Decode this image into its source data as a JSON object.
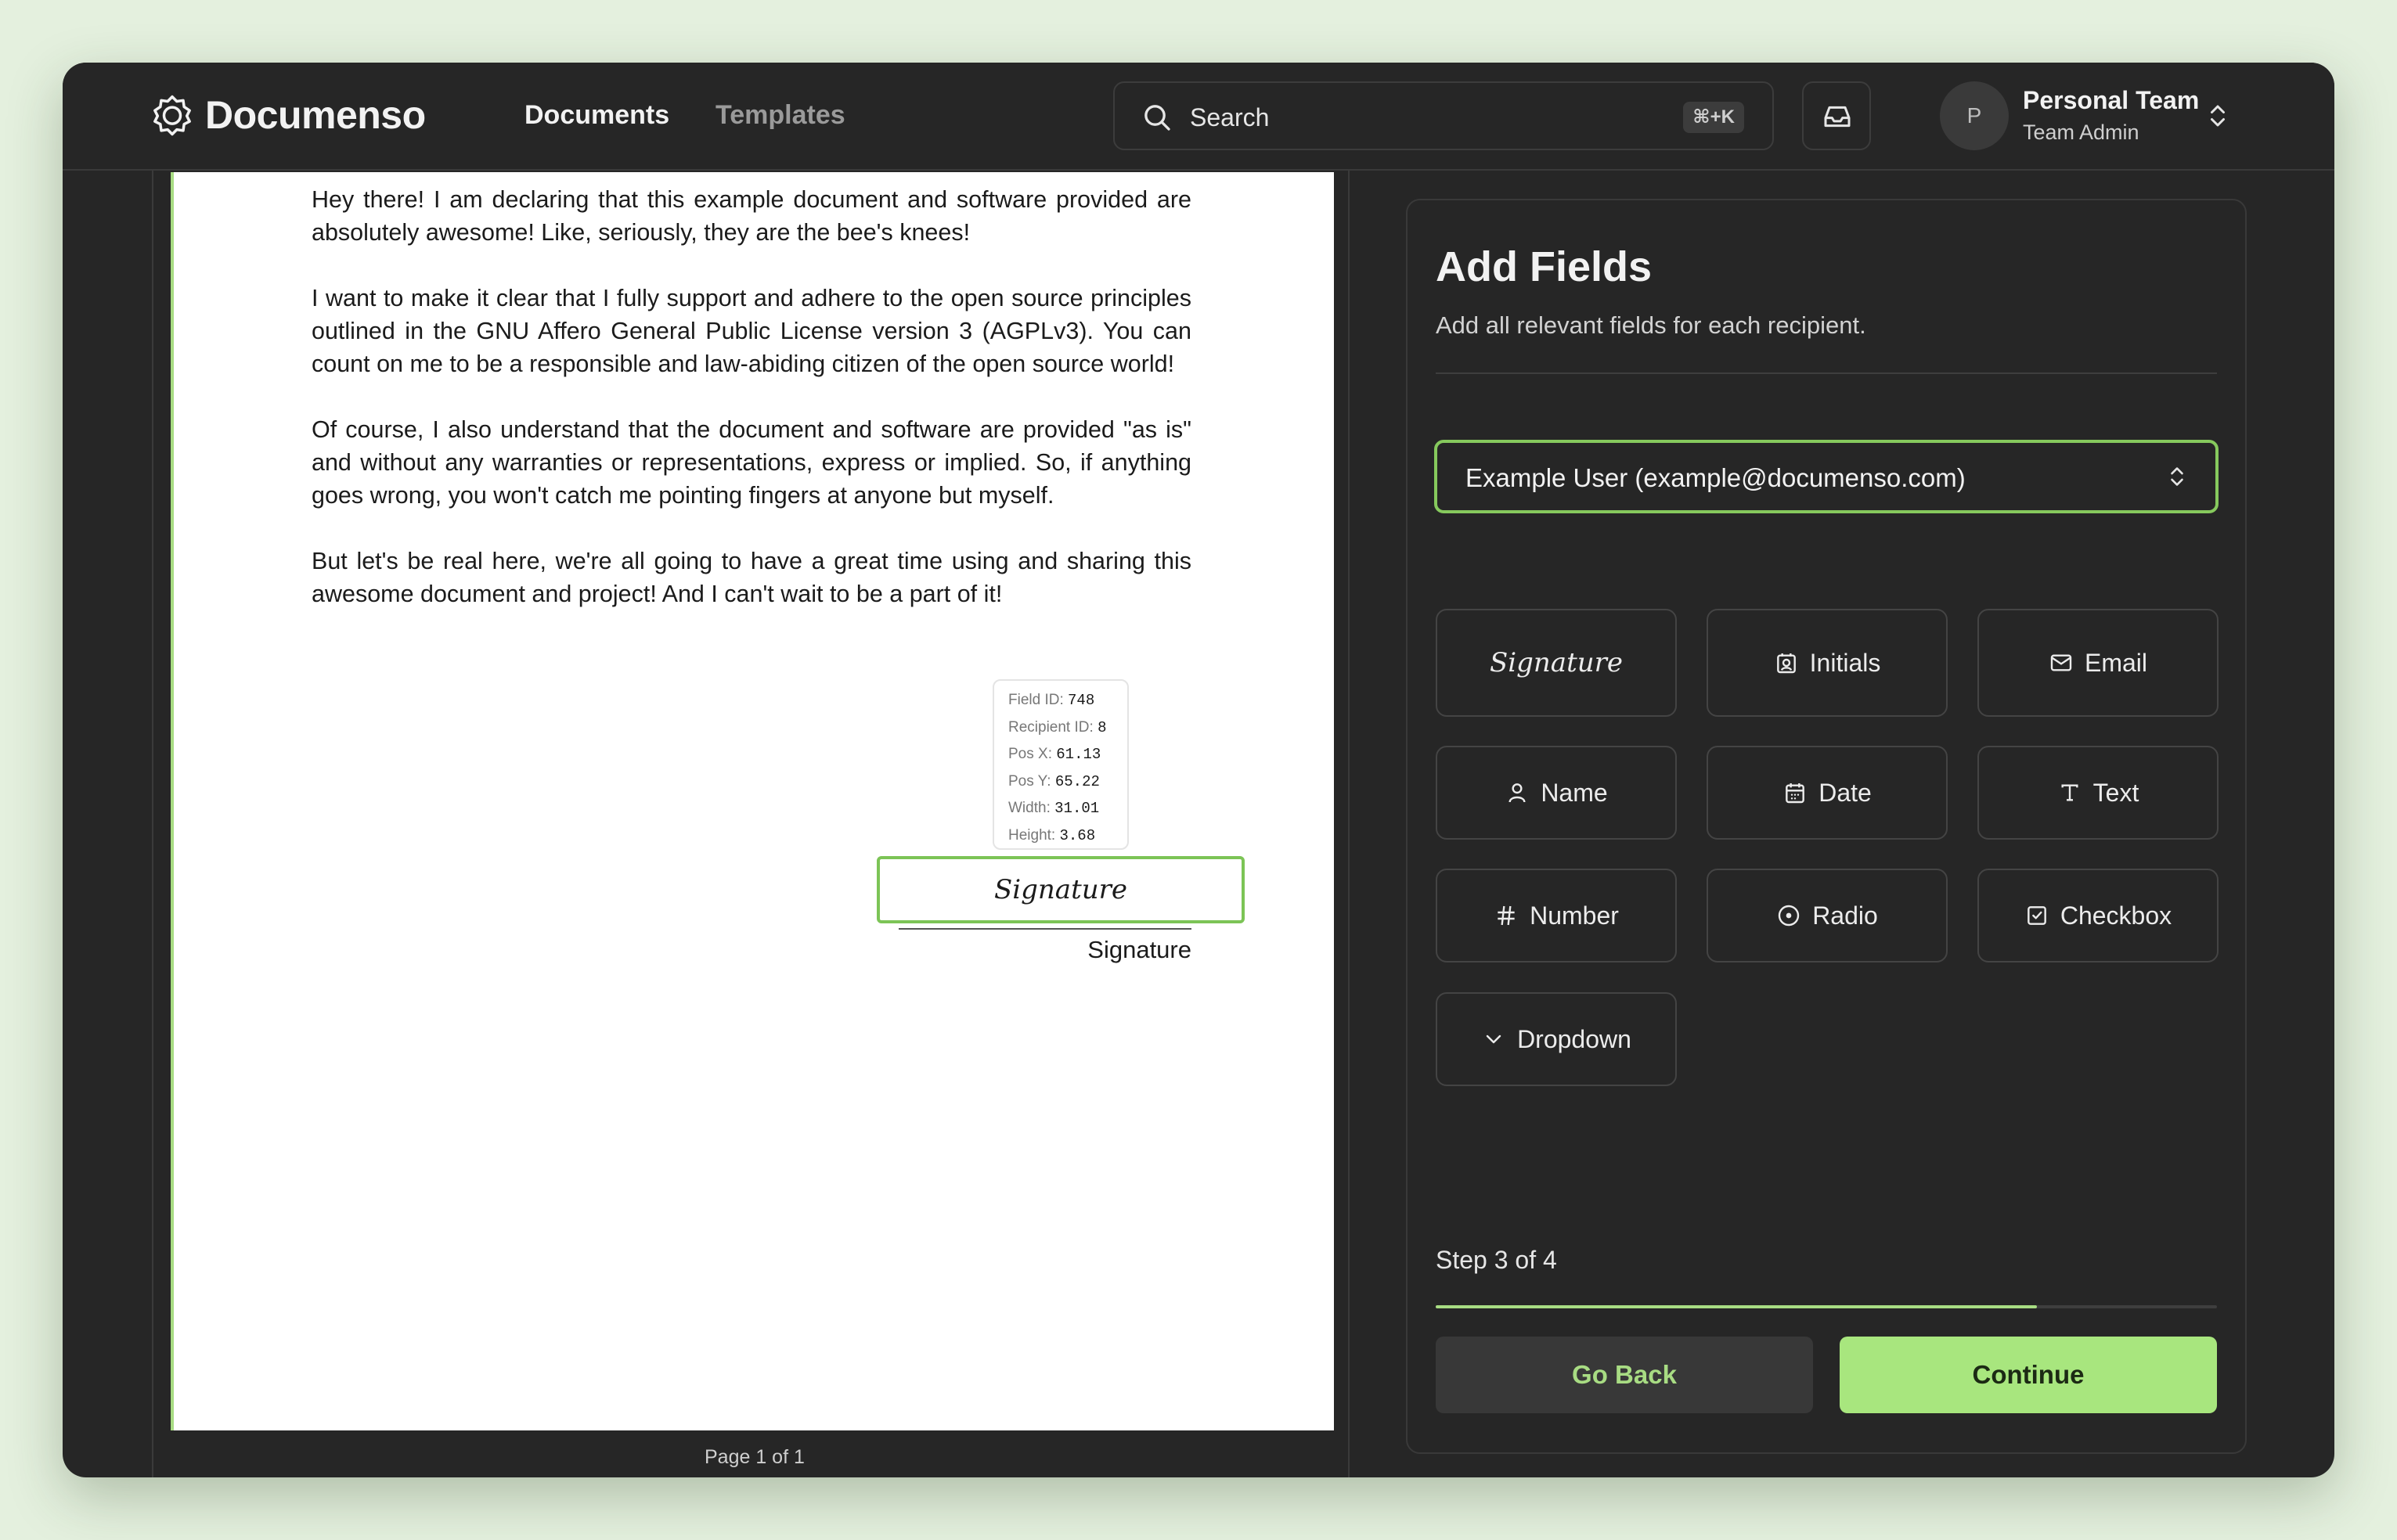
{
  "app": {
    "name": "Documenso",
    "nav": [
      {
        "label": "Documents",
        "active": true
      },
      {
        "label": "Templates",
        "active": false
      }
    ],
    "search": {
      "label": "Search",
      "shortcut": "⌘+K"
    },
    "team": {
      "avatar_initial": "P",
      "name": "Personal Team",
      "role": "Team Admin"
    }
  },
  "document": {
    "paragraphs": [
      "Hey there! I am declaring that this example document and software provided are absolutely awesome! Like, seriously, they are the bee's knees!",
      "I want to make it clear that I fully support and adhere to the open source principles outlined in the GNU Affero General Public License version 3 (AGPLv3). You can count on me to be a responsible and law-abiding citizen of the open source world!",
      "Of course, I also understand that the document and software are provided \"as is\" and without any warranties or representations, express or implied. So, if anything goes wrong, you won't catch me pointing fingers at anyone but myself.",
      "But let's be real here, we're all going to have a great time using and sharing this awesome document and project! And I can't wait to be a part of it!"
    ],
    "field_tooltip": [
      {
        "label": "Field ID:",
        "value": "748"
      },
      {
        "label": "Recipient ID:",
        "value": "8"
      },
      {
        "label": "Pos X:",
        "value": "61.13"
      },
      {
        "label": "Pos Y:",
        "value": "65.22"
      },
      {
        "label": "Width:",
        "value": "31.01"
      },
      {
        "label": "Height:",
        "value": "3.68"
      }
    ],
    "placed_field_label": "Signature",
    "signature_caption": "Signature",
    "page_indicator": "Page 1 of 1"
  },
  "panel": {
    "title": "Add Fields",
    "subtitle": "Add all relevant fields for each recipient.",
    "recipient": "Example User (example@documenso.com)",
    "fields": [
      {
        "label": "Signature",
        "icon": "signature-script"
      },
      {
        "label": "Initials",
        "icon": "contact-icon"
      },
      {
        "label": "Email",
        "icon": "mail-icon"
      },
      {
        "label": "Name",
        "icon": "user-icon"
      },
      {
        "label": "Date",
        "icon": "calendar-icon"
      },
      {
        "label": "Text",
        "icon": "type-icon"
      },
      {
        "label": "Number",
        "icon": "hash-icon"
      },
      {
        "label": "Radio",
        "icon": "radio-icon"
      },
      {
        "label": "Checkbox",
        "icon": "checkbox-icon"
      },
      {
        "label": "Dropdown",
        "icon": "chevron-down-icon"
      }
    ],
    "step": {
      "label": "Step 3 of 4",
      "current": 3,
      "total": 4,
      "progress": 0.77
    },
    "back_label": "Go Back",
    "continue_label": "Continue"
  },
  "colors": {
    "accent": "#a8dc83",
    "window_bg": "#262626",
    "page_bg": "#ffffff",
    "desktop_bg": "#e4f0de"
  }
}
